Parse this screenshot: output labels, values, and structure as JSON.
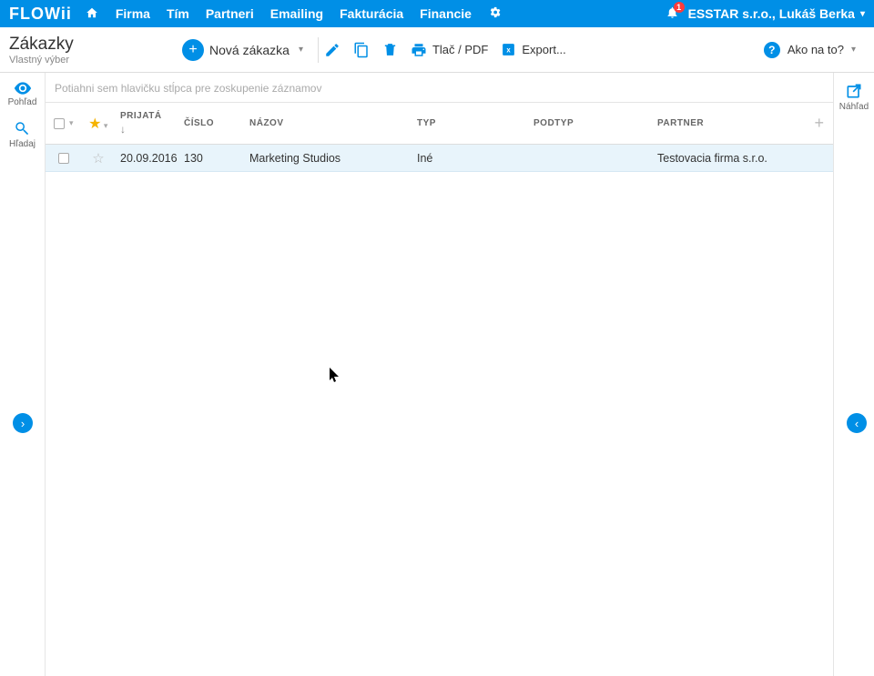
{
  "topnav": {
    "logo": "FLOWii",
    "items": [
      "Firma",
      "Tím",
      "Partneri",
      "Emailing",
      "Fakturácia",
      "Financie"
    ],
    "notif_count": "1",
    "account": "ESSTAR s.r.o., Lukáš Berka"
  },
  "toolbar": {
    "title": "Zákazky",
    "subtitle": "Vlastný výber",
    "new_label": "Nová zákazka",
    "print_label": "Tlač / PDF",
    "export_label": "Export...",
    "help_label": "Ako na to?"
  },
  "sidebar_left": {
    "view": "Pohľad",
    "search": "Hľadaj"
  },
  "sidebar_right": {
    "preview": "Náhľad"
  },
  "grid": {
    "group_hint": "Potiahni sem hlavičku stĺpca pre zoskupenie záznamov",
    "headers": {
      "date": "PRIJATÁ",
      "num": "ČÍSLO",
      "name": "NÁZOV",
      "type": "TYP",
      "subtype": "PODTYP",
      "partner": "PARTNER"
    },
    "rows": [
      {
        "date": "20.09.2016",
        "num": "130",
        "name": "Marketing Studios",
        "type": "Iné",
        "subtype": "",
        "partner": "Testovacia firma s.r.o."
      }
    ]
  }
}
